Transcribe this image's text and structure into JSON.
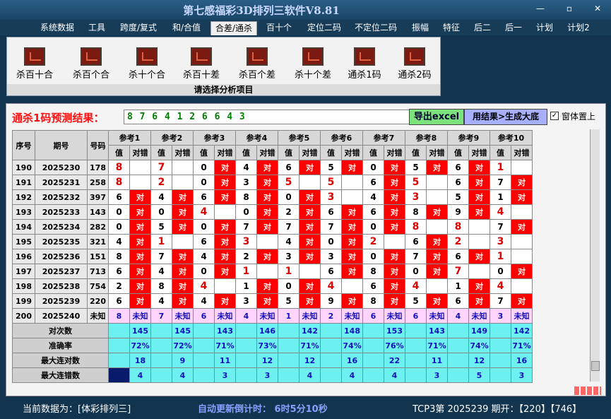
{
  "window": {
    "title": "第七感福彩3D排列三软件V8.81"
  },
  "menu": [
    "系统数据",
    "工具",
    "跨度/复式",
    "和/合值",
    "合差/通杀",
    "百十个",
    "定位二码",
    "不定位二码",
    "振幅",
    "特征",
    "后二",
    "后一",
    "计划",
    "计划2"
  ],
  "tools": {
    "items": [
      "杀百十合",
      "杀百个合",
      "杀十个合",
      "杀百十差",
      "杀百个差",
      "杀十个差",
      "通杀1码",
      "通杀2码"
    ],
    "caption": "请选择分析项目"
  },
  "result": {
    "label": "通杀1码预测结果：",
    "value": "8 7 6 4 1 2 6 6 4 3",
    "excel_btn": "导出excel",
    "gen_btn": "用结果>生成大底",
    "pin_label": "窗体置上"
  },
  "table": {
    "headers": {
      "seq": "序号",
      "period": "期号",
      "number": "号码",
      "val": "值",
      "hit": "对错",
      "refs": [
        "参考1",
        "参考2",
        "参考3",
        "参考4",
        "参考5",
        "参考6",
        "参考7",
        "参考8",
        "参考9",
        "参考10"
      ]
    },
    "hit_text": "对",
    "rows": [
      {
        "seq": "190",
        "period": "2025230",
        "number": "178",
        "vals": [
          "8",
          "7",
          "0",
          "4",
          "6",
          "5",
          "0",
          "5",
          "6",
          "1"
        ],
        "red": [
          1,
          1,
          0,
          0,
          0,
          0,
          0,
          0,
          0,
          1
        ],
        "hits": [
          0,
          0,
          1,
          1,
          1,
          1,
          1,
          1,
          1,
          0
        ]
      },
      {
        "seq": "191",
        "period": "2025231",
        "number": "258",
        "vals": [
          "8",
          "2",
          "0",
          "3",
          "5",
          "5",
          "6",
          "5",
          "6",
          "7"
        ],
        "red": [
          1,
          1,
          0,
          0,
          1,
          1,
          0,
          1,
          0,
          0
        ],
        "hits": [
          0,
          0,
          1,
          1,
          0,
          0,
          1,
          0,
          1,
          1
        ]
      },
      {
        "seq": "192",
        "period": "2025232",
        "number": "397",
        "vals": [
          "6",
          "4",
          "6",
          "8",
          "0",
          "3",
          "4",
          "3",
          "5",
          "1"
        ],
        "red": [
          0,
          0,
          0,
          0,
          0,
          1,
          0,
          1,
          0,
          0
        ],
        "hits": [
          1,
          1,
          1,
          1,
          1,
          0,
          1,
          0,
          1,
          1
        ]
      },
      {
        "seq": "193",
        "period": "2025233",
        "number": "143",
        "vals": [
          "0",
          "0",
          "4",
          "0",
          "2",
          "6",
          "6",
          "8",
          "9",
          "4"
        ],
        "red": [
          0,
          0,
          1,
          0,
          0,
          0,
          0,
          0,
          0,
          1
        ],
        "hits": [
          1,
          1,
          0,
          1,
          1,
          1,
          1,
          1,
          1,
          0
        ]
      },
      {
        "seq": "194",
        "period": "2025234",
        "number": "282",
        "vals": [
          "0",
          "5",
          "0",
          "7",
          "7",
          "7",
          "0",
          "8",
          "8",
          "7"
        ],
        "red": [
          0,
          0,
          0,
          0,
          0,
          0,
          0,
          1,
          1,
          0
        ],
        "hits": [
          1,
          1,
          1,
          1,
          1,
          1,
          1,
          0,
          0,
          1
        ]
      },
      {
        "seq": "195",
        "period": "2025235",
        "number": "321",
        "vals": [
          "4",
          "1",
          "6",
          "3",
          "4",
          "0",
          "2",
          "6",
          "2",
          "3"
        ],
        "red": [
          0,
          1,
          0,
          1,
          0,
          0,
          1,
          0,
          1,
          1
        ],
        "hits": [
          1,
          0,
          1,
          0,
          1,
          1,
          0,
          1,
          0,
          0
        ]
      },
      {
        "seq": "196",
        "period": "2025236",
        "number": "151",
        "vals": [
          "8",
          "7",
          "4",
          "2",
          "3",
          "3",
          "0",
          "7",
          "6",
          "1"
        ],
        "red": [
          0,
          0,
          0,
          0,
          0,
          0,
          0,
          0,
          0,
          1
        ],
        "hits": [
          1,
          1,
          1,
          1,
          1,
          1,
          1,
          1,
          1,
          0
        ]
      },
      {
        "seq": "197",
        "period": "2025237",
        "number": "713",
        "vals": [
          "6",
          "4",
          "0",
          "1",
          "1",
          "6",
          "8",
          "0",
          "7",
          "0"
        ],
        "red": [
          0,
          0,
          0,
          1,
          1,
          0,
          0,
          0,
          1,
          0
        ],
        "hits": [
          1,
          1,
          1,
          0,
          0,
          1,
          1,
          1,
          0,
          1
        ]
      },
      {
        "seq": "198",
        "period": "2025238",
        "number": "754",
        "vals": [
          "2",
          "8",
          "4",
          "1",
          "0",
          "4",
          "6",
          "4",
          "1",
          "4"
        ],
        "red": [
          0,
          0,
          1,
          0,
          0,
          1,
          0,
          1,
          0,
          1
        ],
        "hits": [
          1,
          1,
          0,
          1,
          1,
          0,
          1,
          0,
          1,
          0
        ]
      },
      {
        "seq": "199",
        "period": "2025239",
        "number": "220",
        "vals": [
          "6",
          "4",
          "4",
          "3",
          "5",
          "9",
          "8",
          "5",
          "6",
          "7"
        ],
        "red": [
          0,
          0,
          0,
          0,
          0,
          0,
          0,
          0,
          0,
          0
        ],
        "hits": [
          1,
          1,
          1,
          1,
          1,
          1,
          1,
          1,
          1,
          1
        ]
      }
    ],
    "unknown_row": {
      "seq": "200",
      "period": "2025240",
      "number": "未知",
      "vals": [
        "8",
        "7",
        "6",
        "4",
        "1",
        "2",
        "6",
        "6",
        "4",
        "3"
      ],
      "text": "未知"
    },
    "stats": [
      {
        "label": "对次数",
        "values": [
          "145",
          "145",
          "143",
          "146",
          "142",
          "148",
          "153",
          "143",
          "149",
          "142"
        ]
      },
      {
        "label": "准确率",
        "values": [
          "72%",
          "72%",
          "71%",
          "73%",
          "71%",
          "74%",
          "76%",
          "71%",
          "74%",
          "71%"
        ]
      },
      {
        "label": "最大连对数",
        "values": [
          "18",
          "9",
          "11",
          "12",
          "12",
          "16",
          "22",
          "11",
          "12",
          "16"
        ]
      },
      {
        "label": "最大连错数",
        "values": [
          "4",
          "4",
          "3",
          "3",
          "4",
          "4",
          "4",
          "3",
          "5",
          "3"
        ]
      }
    ]
  },
  "status": {
    "data_source": "当前数据为：[体彩排列三]",
    "countdown": "自动更新倒计时： 6时5分10秒",
    "period_info": "TCP3第 2025239 期开：【220】【746】"
  }
}
